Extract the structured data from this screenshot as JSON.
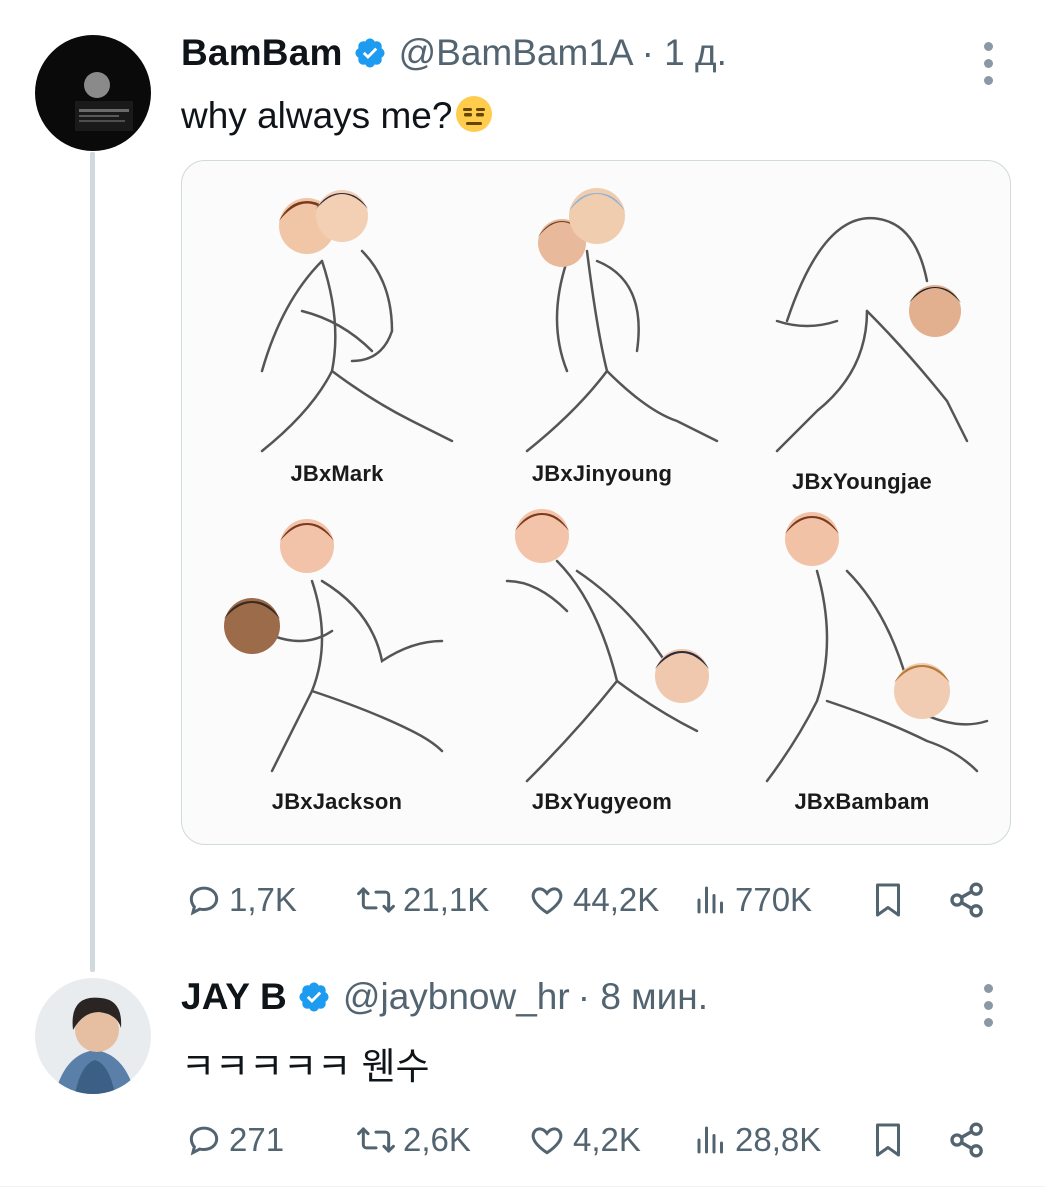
{
  "tweet": {
    "author_name": "BamBam",
    "handle": "@BamBam1A",
    "time": "· 1 д.",
    "text": "why always me?",
    "emoji": "expressionless-face-emoji",
    "media": {
      "labels": [
        "JBxMark",
        "JBxJinyoung",
        "JBxYoungjae",
        "JBxJackson",
        "JBxYugyeom",
        "JBxBambam"
      ]
    },
    "stats": {
      "replies": "1,7K",
      "reposts": "21,1K",
      "likes": "44,2K",
      "views": "770K"
    }
  },
  "reply": {
    "author_name": "JAY B",
    "handle": "@jaybnow_hr",
    "time": "· 8 мин.",
    "text": "ㅋㅋㅋㅋㅋ 웬수",
    "stats": {
      "replies": "271",
      "reposts": "2,6K",
      "likes": "4,2K",
      "views": "28,8K"
    }
  },
  "colors": {
    "verified": "#1d9bf0",
    "muted": "#536471",
    "thread_line": "#cfd9de"
  }
}
